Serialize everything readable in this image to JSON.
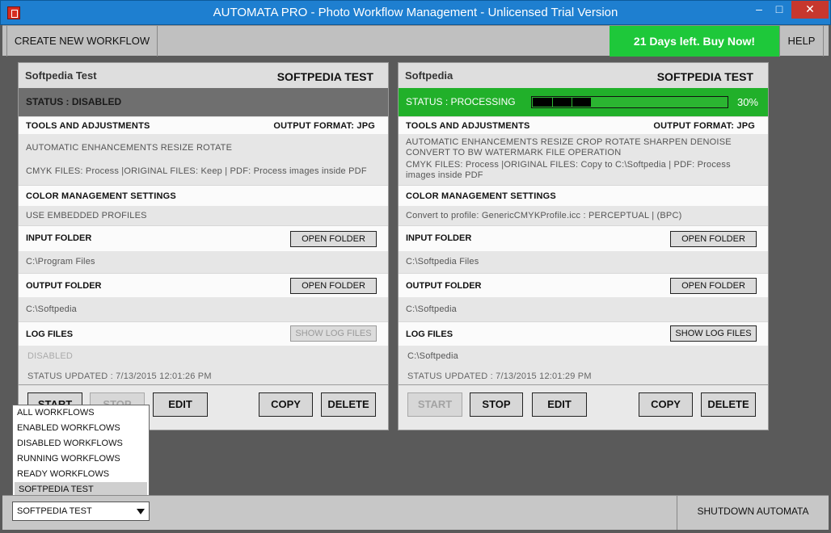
{
  "window": {
    "title": "AUTOMATA PRO - Photo Workflow Management - Unlicensed Trial Version",
    "min_glyph": "–",
    "max_glyph": "□",
    "close_glyph": "✕"
  },
  "toolbar": {
    "create_label": "CREATE NEW WORKFLOW",
    "buy_label": "21 Days left. Buy Now!",
    "help_label": "HELP"
  },
  "workflows": [
    {
      "name": "Softpedia Test",
      "title": "SOFTPEDIA TEST",
      "status": "STATUS : DISABLED",
      "tools_heading": "TOOLS AND ADJUSTMENTS",
      "output_format": "OUTPUT FORMAT: JPG",
      "tools_list": "AUTOMATIC ENHANCEMENTS  RESIZE  ROTATE",
      "file_options": "CMYK FILES: Process |ORIGINAL FILES: Keep | PDF: Process images inside PDF",
      "color_heading": "COLOR MANAGEMENT SETTINGS",
      "color_value": "USE EMBEDDED PROFILES",
      "input_heading": "INPUT FOLDER",
      "input_button": "OPEN FOLDER",
      "input_path": "C:\\Program Files",
      "output_heading": "OUTPUT FOLDER",
      "output_button": "OPEN FOLDER",
      "output_path": "C:\\Softpedia",
      "log_heading": "LOG FILES",
      "log_button": "SHOW LOG FILES",
      "log_value": "DISABLED",
      "updated": "STATUS UPDATED : 7/13/2015 12:01:26 PM",
      "start": "START",
      "stop": "STOP",
      "edit": "EDIT",
      "copy": "COPY",
      "delete": "DELETE"
    },
    {
      "name": "Softpedia",
      "title": "SOFTPEDIA TEST",
      "status": "STATUS : PROCESSING",
      "progress_text": "30%",
      "progress_value": 0.3,
      "tools_heading": "TOOLS AND ADJUSTMENTS",
      "output_format": "OUTPUT FORMAT: JPG",
      "tools_list": "AUTOMATIC ENHANCEMENTS  RESIZE  CROP  ROTATE  SHARPEN  DENOISE  CONVERT TO BW  WATERMARK  FILE OPERATION",
      "file_options": "CMYK FILES: Process |ORIGINAL FILES: Copy to C:\\Softpedia | PDF: Process images inside PDF",
      "color_heading": "COLOR MANAGEMENT SETTINGS",
      "color_value": "Convert to profile: GenericCMYKProfile.icc : PERCEPTUAL | (BPC)",
      "input_heading": "INPUT FOLDER",
      "input_button": "OPEN FOLDER",
      "input_path": "C:\\Softpedia Files",
      "output_heading": "OUTPUT FOLDER",
      "output_button": "OPEN FOLDER",
      "output_path": "C:\\Softpedia",
      "log_heading": "LOG FILES",
      "log_button": "SHOW LOG FILES",
      "log_value": "C:\\Softpedia",
      "updated": "STATUS UPDATED : 7/13/2015 12:01:29 PM",
      "start": "START",
      "stop": "STOP",
      "edit": "EDIT",
      "copy": "COPY",
      "delete": "DELETE"
    }
  ],
  "filter": {
    "options": [
      "ALL WORKFLOWS",
      "ENABLED WORKFLOWS",
      "DISABLED WORKFLOWS",
      "RUNNING WORKFLOWS",
      "READY WORKFLOWS",
      "SOFTPEDIA TEST"
    ],
    "selected": "SOFTPEDIA TEST"
  },
  "footer": {
    "shutdown_label": "SHUTDOWN AUTOMATA"
  },
  "colors": {
    "titlebar": "#1e7fd0",
    "buy_button": "#1ec83a",
    "status_processing": "#21b02a",
    "status_disabled": "#6f6f6f"
  }
}
